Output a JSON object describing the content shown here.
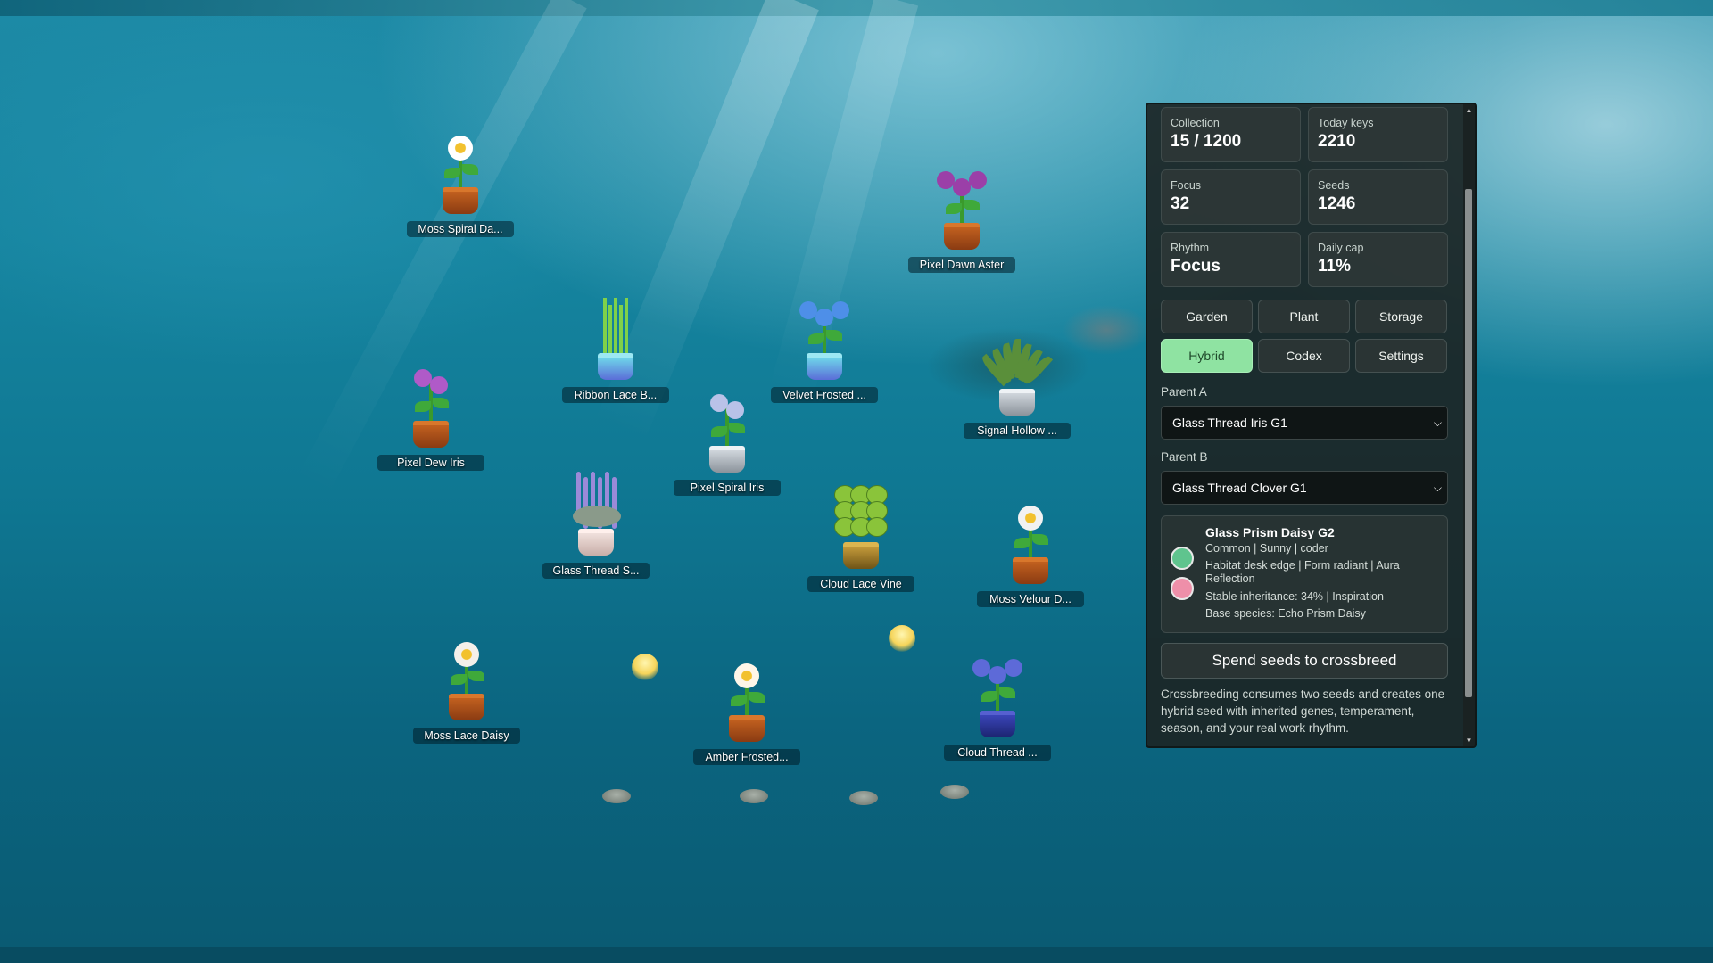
{
  "plants": [
    {
      "name": "Moss Spiral Da...",
      "type": "daisy",
      "pot": "terracotta",
      "color": "#ffffff"
    },
    {
      "name": "Pixel Dawn Aster",
      "type": "aster",
      "pot": "terracotta",
      "color": "#9b3fa8"
    },
    {
      "name": "Ribbon Lace B...",
      "type": "bamboo",
      "pot": "ceramic",
      "color": "#7ccf4a"
    },
    {
      "name": "Velvet Frosted ...",
      "type": "poppy",
      "pot": "ceramic",
      "color": "#4e8fe8"
    },
    {
      "name": "Signal Hollow ...",
      "type": "spider",
      "pot": "grey",
      "color": "#4f8a3a"
    },
    {
      "name": "Pixel Dew Iris",
      "type": "iris",
      "pot": "terracotta",
      "color": "#b05ac8"
    },
    {
      "name": "Pixel Spiral Iris",
      "type": "iris",
      "pot": "grey",
      "color": "#b9c2e8"
    },
    {
      "name": "Glass Thread S...",
      "type": "lavender",
      "pot": "white",
      "color": "#9b8ad8"
    },
    {
      "name": "Cloud Lace Vine",
      "type": "vine",
      "pot": "brass",
      "color": "#8ac43a"
    },
    {
      "name": "Moss Velour D...",
      "type": "daisy",
      "pot": "terracotta",
      "color": "#f2f2f2"
    },
    {
      "name": "Moss Lace Daisy",
      "type": "daisy",
      "pot": "terracotta",
      "color": "#f5f0ea"
    },
    {
      "name": "Amber Frosted...",
      "type": "daisy",
      "pot": "terracotta",
      "color": "#fff6e8"
    },
    {
      "name": "Cloud Thread ...",
      "type": "bluebell",
      "pot": "blue",
      "color": "#5d6ad8"
    }
  ],
  "stats": {
    "collection": {
      "label": "Collection",
      "value": "15 / 1200"
    },
    "today_keys": {
      "label": "Today keys",
      "value": "2210"
    },
    "focus": {
      "label": "Focus",
      "value": "32"
    },
    "seeds": {
      "label": "Seeds",
      "value": "1246"
    },
    "rhythm": {
      "label": "Rhythm",
      "value": "Focus"
    },
    "daily_cap": {
      "label": "Daily cap",
      "value": "11%"
    }
  },
  "tabs": {
    "garden": "Garden",
    "plant": "Plant",
    "storage": "Storage",
    "hybrid": "Hybrid",
    "codex": "Codex",
    "settings": "Settings"
  },
  "parent_a": {
    "label": "Parent A",
    "value": "Glass Thread Iris G1"
  },
  "parent_b": {
    "label": "Parent B",
    "value": "Glass Thread Clover G1"
  },
  "result": {
    "title": "Glass Prism Daisy G2",
    "line1": "Common | Sunny | coder",
    "line2": "Habitat desk edge | Form radiant | Aura Reflection",
    "line3": "Stable inheritance: 34% | Inspiration",
    "line4": "Base species: Echo Prism Daisy",
    "color_a": "#5fc48e",
    "color_b": "#ee8fa9"
  },
  "crossbreed_button": "Spend seeds to crossbreed",
  "description": "Crossbreeding consumes two seeds and creates one hybrid seed with inherited genes, temperament, season, and your real work rhythm."
}
